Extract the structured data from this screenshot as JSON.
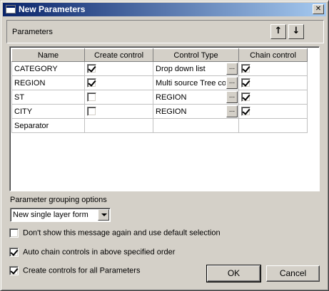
{
  "window": {
    "title": "New Parameters",
    "close_glyph": "✕"
  },
  "parameters_group": {
    "label": "Parameters",
    "move_up_glyph": "↑",
    "move_down_glyph": "↓"
  },
  "grid": {
    "columns": [
      "Name",
      "Create control",
      "Control Type",
      "Chain control"
    ],
    "rows": [
      {
        "name": "CATEGORY",
        "create": true,
        "control_type": "Drop down list",
        "chain": true,
        "has_button": true
      },
      {
        "name": "REGION",
        "create": true,
        "control_type": "Multi source Tree co",
        "chain": true,
        "has_button": true
      },
      {
        "name": "ST",
        "create": false,
        "control_type": "REGION",
        "chain": true,
        "has_button": true
      },
      {
        "name": "CITY",
        "create": false,
        "control_type": "REGION",
        "chain": true,
        "has_button": true
      },
      {
        "name": "Separator",
        "create": null,
        "control_type": "",
        "chain": null,
        "has_button": false
      }
    ],
    "ellipsis": "..."
  },
  "grouping": {
    "label": "Parameter grouping options",
    "selected": "New single layer form"
  },
  "options": [
    {
      "label": "Don't show this message again and use default selection",
      "checked": false
    },
    {
      "label": "Auto chain controls in above specified order",
      "checked": true
    },
    {
      "label": "Create controls for all Parameters",
      "checked": true
    }
  ],
  "buttons": {
    "ok": "OK",
    "cancel": "Cancel"
  }
}
